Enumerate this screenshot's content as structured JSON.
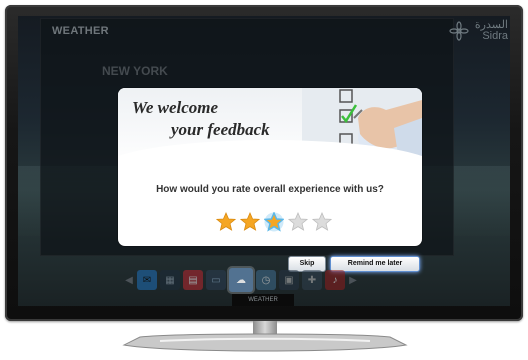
{
  "screen": {
    "section_title": "WEATHER",
    "city": "NEW YORK",
    "brand": {
      "arabic": "السدرة",
      "latin": "Sidra"
    }
  },
  "dialog": {
    "headline_line1": "We welcome",
    "headline_line2": "your feedback",
    "question": "How would you rate overall experience with us?",
    "rating": {
      "value": 3,
      "max": 5,
      "selected_index": 3
    }
  },
  "buttons": {
    "skip_label": "Skip",
    "remind_label": "Remind me later"
  },
  "app_bar": {
    "active_label": "WEATHER",
    "apps": [
      "mail-icon",
      "film-icon",
      "calendar-icon",
      "tv-icon",
      "weather-icon",
      "clock-icon",
      "box-icon",
      "puzzle-icon",
      "music-icon"
    ]
  },
  "colors": {
    "star_filled": "#f5a623",
    "star_selected": "#5ab7e8",
    "star_empty": "#c8c8c8",
    "remind_focus": "#5f8fd0"
  }
}
